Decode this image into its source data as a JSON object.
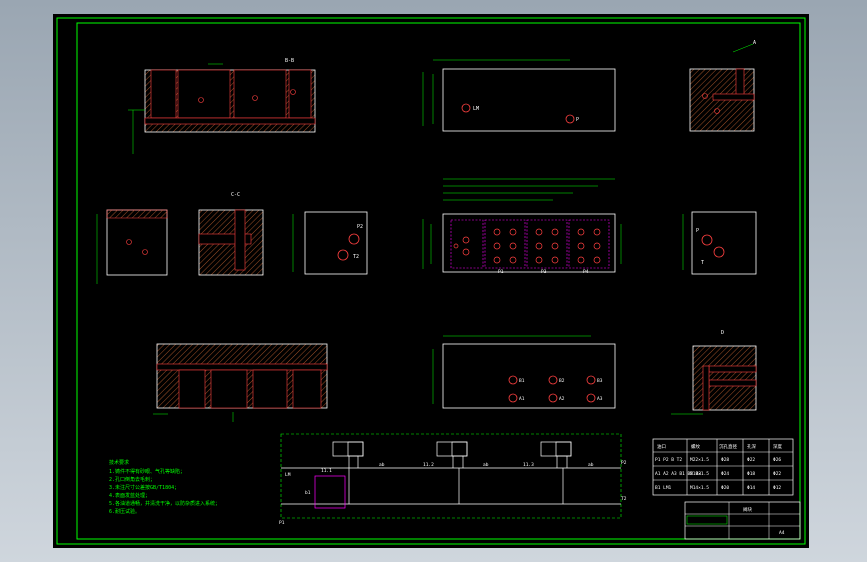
{
  "colors": {
    "background": "#000000",
    "frame": "#00ff00",
    "outline": "#ffffff",
    "hatch": "#c86432",
    "oil_passage": "#ff4040",
    "dimension": "#00ff00",
    "dash_box": "#ff00ff",
    "text": "#ffffff",
    "frame_outer_bg": "#9aa6b2"
  },
  "labels": {
    "title_corner": "A4",
    "view_left_top": "B-B",
    "view_right_top": "A",
    "view_left_mid": "C-C",
    "view_right_bottom": "D",
    "port_lm": "LM",
    "port_p": "P",
    "port_t": "T",
    "port_t2": "T2",
    "port_p1": "P1",
    "port_p2": "P2",
    "port_p3": "P3",
    "port_p4": "P4",
    "port_a1": "A1",
    "port_a2": "A2",
    "port_a3": "A3",
    "port_b1": "B1",
    "port_b2": "B2",
    "port_b3": "B3",
    "valve_1": "11.1",
    "valve_2": "11.2",
    "valve_3": "11.3",
    "ab_label": "ab",
    "b1_valve": "b1"
  },
  "notes": {
    "heading": "技术要求",
    "lines": [
      "1.铸件不得有砂眼、气孔等缺陷；",
      "2.孔口倒角去毛刺；",
      "3.未注尺寸公差按GB/T1804；",
      "4.表面发蓝处理；",
      "5.各油道通畅，并清洗干净，以防杂质进入系统；",
      "6.耐压试验。"
    ]
  },
  "port_table": {
    "headers": [
      "油口",
      "螺纹",
      "沉孔直径",
      "孔深",
      "深度"
    ],
    "rows": [
      [
        "P1 P2 B T2",
        "M22×1.5",
        "Φ28",
        "Φ22",
        "Φ26"
      ],
      [
        "A1 A2 A3 B1 B2 B3",
        "M18×1.5",
        "Φ24",
        "Φ18",
        "Φ22"
      ],
      [
        "B1 LM1",
        "M14×1.5",
        "Φ20",
        "Φ14",
        "Φ12"
      ]
    ]
  },
  "title_block": {
    "part_name": "阀块",
    "scale": "A4"
  }
}
